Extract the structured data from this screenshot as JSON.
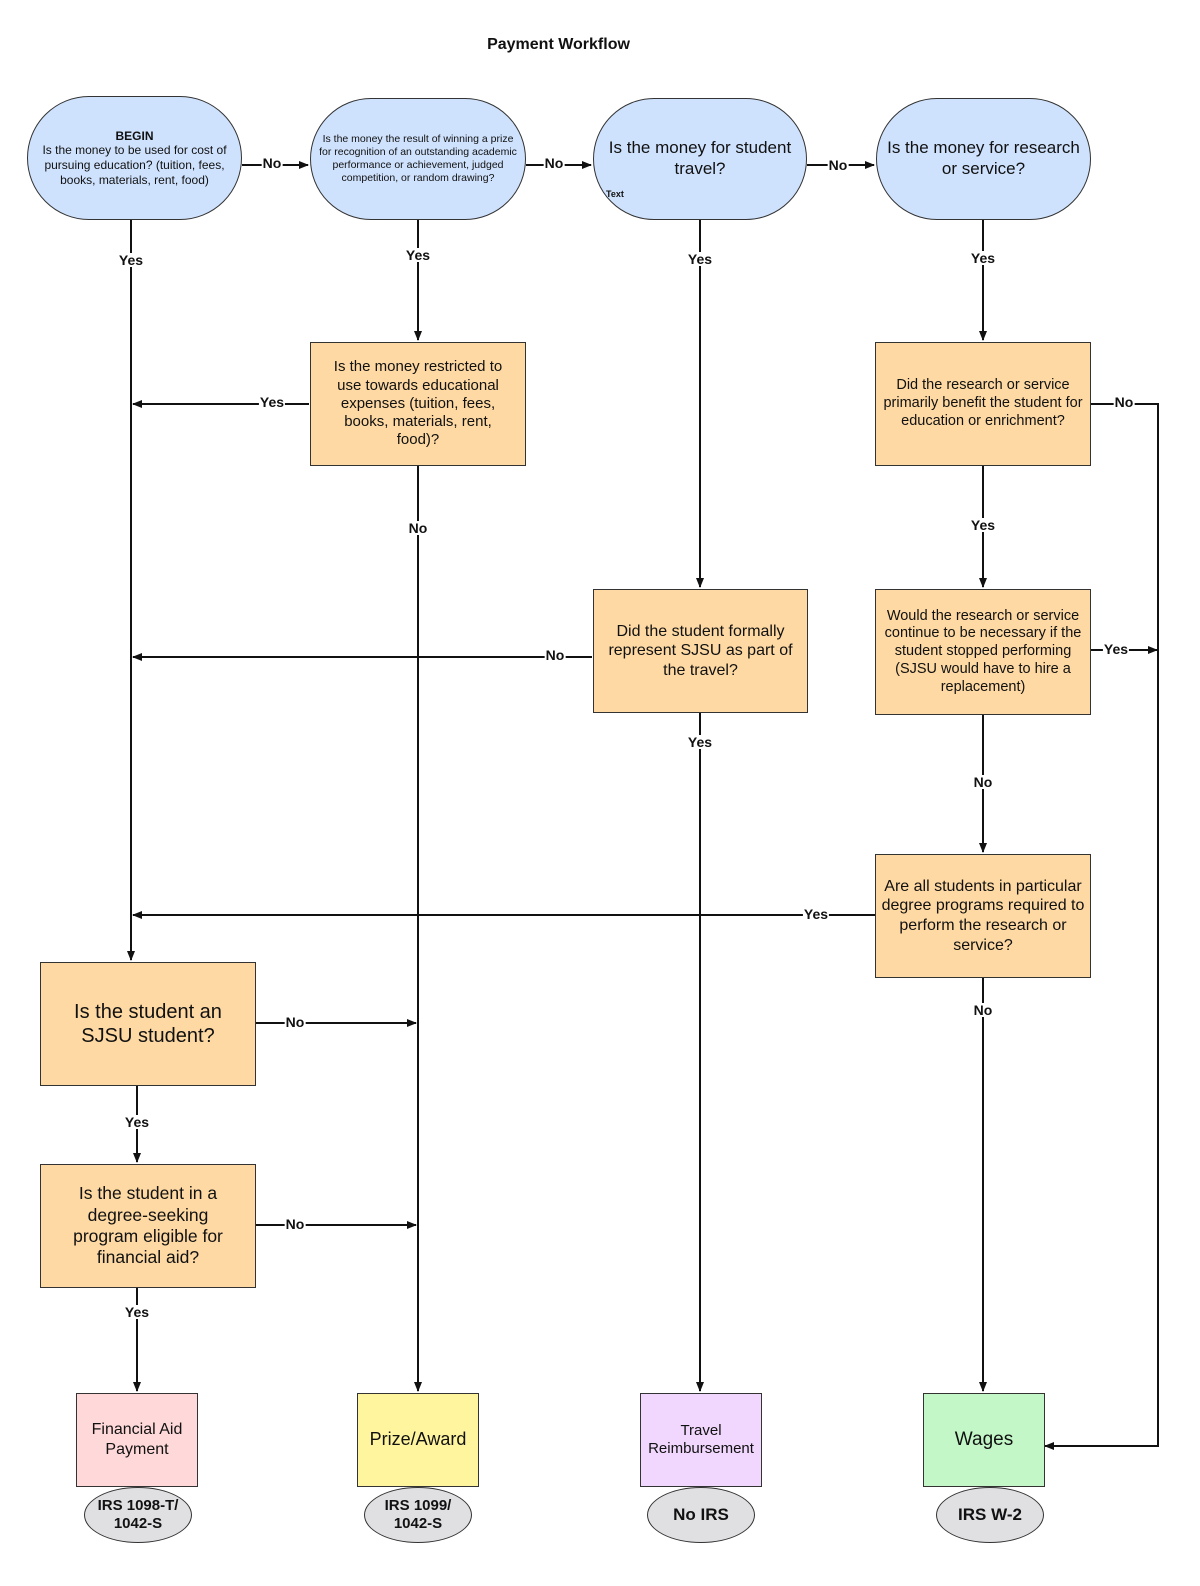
{
  "title": "Payment Workflow",
  "decisions": {
    "begin": {
      "heading": "BEGIN",
      "text": "Is the money to be used for cost of pursuing education? (tuition, fees, books, materials, rent, food)"
    },
    "prize": {
      "text": "Is the money the result of winning a prize for recognition of an outstanding academic performance or achievement, judged competition, or random drawing?"
    },
    "travel": {
      "text": "Is the money for student travel?",
      "placeholder": "Text"
    },
    "research": {
      "text": "Is the money for research or service?"
    },
    "restricted": {
      "text": "Is the money restricted to use towards educational expenses (tuition, fees, books, materials, rent, food)?"
    },
    "benefit": {
      "text": "Did the research or service primarily benefit the student for education or enrichment?"
    },
    "represent": {
      "text": "Did the student formally represent SJSU as part of the travel?"
    },
    "continue": {
      "text": "Would the research or service continue to be necessary if the student stopped performing (SJSU would have to hire a replacement)"
    },
    "required": {
      "text": "Are all students in particular degree programs required to perform the research or service?"
    },
    "sjsu": {
      "text": "Is the student an SJSU student?"
    },
    "degree": {
      "text": "Is the student in a degree-seeking program eligible for financial aid?"
    }
  },
  "outcomes": [
    {
      "id": "finaid",
      "label": "Financial Aid Payment",
      "irs": "IRS 1098-T/ 1042-S",
      "color": "#ffd9d9"
    },
    {
      "id": "prize",
      "label": "Prize/Award",
      "irs": "IRS 1099/ 1042-S",
      "color": "#fff59f"
    },
    {
      "id": "travel",
      "label": "Travel Reimbursement",
      "irs": "No IRS",
      "color": "#f1d7fd"
    },
    {
      "id": "wages",
      "label": "Wages",
      "irs": "IRS W-2",
      "color": "#c3f7c8"
    }
  ],
  "edges": {
    "yes": "Yes",
    "no": "No"
  }
}
